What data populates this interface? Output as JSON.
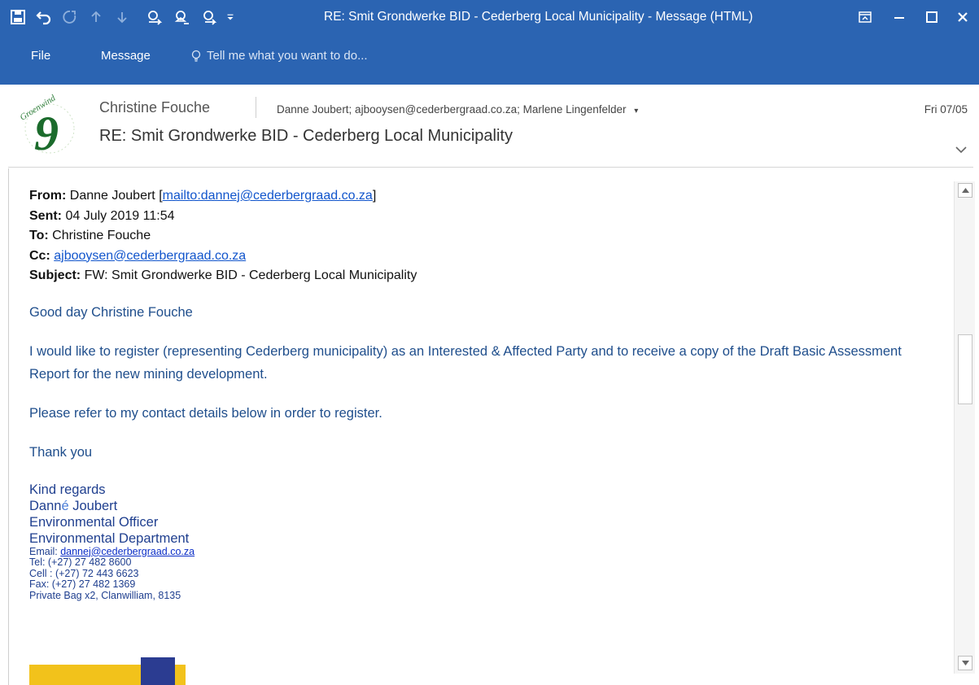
{
  "window": {
    "title": "RE: Smit Grondwerke BID - Cederberg Local Municipality - Message (HTML)",
    "quick_access": [
      "save-icon",
      "undo-icon",
      "redo-icon",
      "up-arrow-icon",
      "down-arrow-icon",
      "reply-icon",
      "reply-all-icon",
      "forward-icon",
      "customize-dropdown-icon"
    ],
    "controls": [
      "ribbon-display-icon",
      "minimize-icon",
      "maximize-icon",
      "close-icon"
    ]
  },
  "ribbon": {
    "tabs": [
      "File",
      "Message"
    ],
    "tell_me": "Tell me what you want to do..."
  },
  "header": {
    "logo_text": "Groenwind",
    "logo_digit": "9",
    "sender": "Christine Fouche",
    "recipients": "Danne Joubert; ajbooysen@cederbergraad.co.za; Marlene Lingenfelder",
    "date": "Fri 07/05",
    "subject": "RE: Smit Grondwerke BID - Cederberg Local Municipality"
  },
  "message": {
    "from_label": "From:",
    "from_name": "Danne Joubert [",
    "from_link": "mailto:dannej@cederbergraad.co.za",
    "from_end": "]",
    "sent_label": "Sent:",
    "sent_value": "04 July 2019 11:54",
    "to_label": "To:",
    "to_value": "Christine Fouche",
    "cc_label": "Cc:",
    "cc_link": "ajbooysen@cederbergraad.co.za",
    "subject_label": "Subject:",
    "subject_value": "FW: Smit Grondwerke BID - Cederberg Local Municipality",
    "greeting": "Good day Christine Fouche",
    "paragraph1": "I would like to register (representing Cederberg municipality) as an Interested & Affected Party and to receive a copy of the Draft Basic Assessment Report for the new mining development.",
    "paragraph2": "Please refer to my contact details below in order to register.",
    "thanks": "Thank you",
    "signature": {
      "closing": "Kind regards",
      "name_start": "Dann",
      "name_accent": "é",
      "name_end": " Joubert",
      "title": "Environmental Officer",
      "department": "Environmental Department",
      "email_label": "Email: ",
      "email": "dannej@cederbergraad.co.za",
      "tel": "Tel: (+27) 27 482 8600",
      "cell": "Cell : (+27) 72 443 6623",
      "fax": "Fax: (+27) 27 482 1369",
      "address": "Private Bag x2, Clanwilliam, 8135"
    }
  },
  "colors": {
    "titlebar": "#2b64b2",
    "link": "#1155cc",
    "body_text": "#1f4e8c",
    "banner_yellow": "#f2c21b",
    "banner_blue": "#2b3c91"
  }
}
